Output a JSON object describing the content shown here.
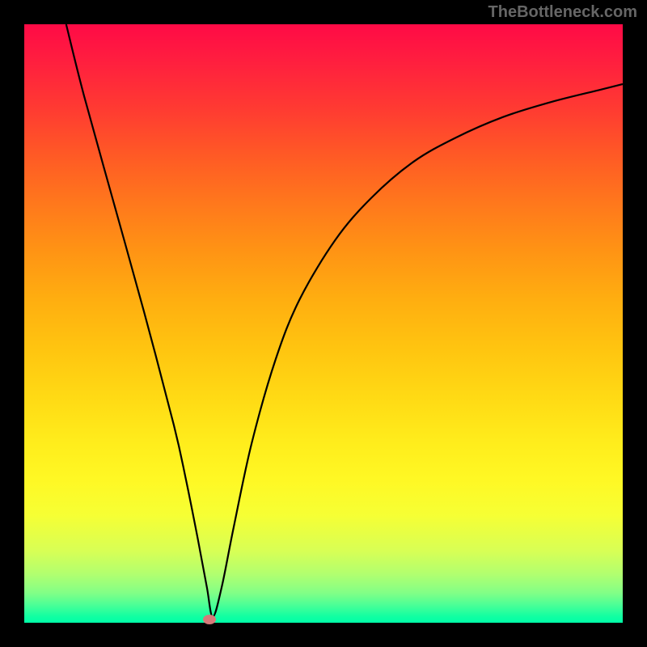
{
  "watermark": "TheBottleneck.com",
  "chart_data": {
    "type": "line",
    "title": "",
    "xlabel": "",
    "ylabel": "",
    "xlim": [
      0,
      100
    ],
    "ylim": [
      0,
      100
    ],
    "series": [
      {
        "name": "bottleneck-curve",
        "x": [
          7,
          10,
          15,
          20,
          25,
          27,
          29,
          30.5,
          31.5,
          33,
          35,
          38,
          42,
          46,
          52,
          58,
          65,
          72,
          80,
          88,
          96,
          100
        ],
        "y": [
          100,
          88,
          70,
          52,
          33,
          24,
          14,
          6,
          1,
          6,
          16,
          30,
          44,
          54,
          64,
          71,
          77,
          81,
          84.5,
          87,
          89,
          90
        ]
      }
    ],
    "marker": {
      "name": "optimum",
      "x": 31,
      "y": 0.5
    },
    "gradient": {
      "direction": "vertical",
      "stops": [
        {
          "pos": 0,
          "color": "#ff0a46"
        },
        {
          "pos": 50,
          "color": "#ffc410"
        },
        {
          "pos": 80,
          "color": "#fff824"
        },
        {
          "pos": 100,
          "color": "#00ffa8"
        }
      ]
    }
  }
}
